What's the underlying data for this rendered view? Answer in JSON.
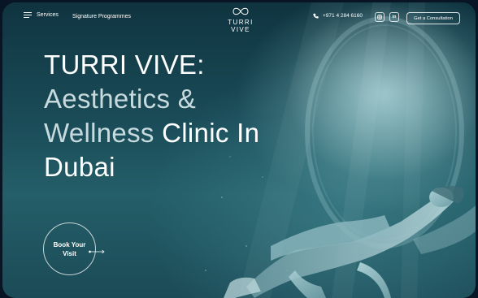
{
  "header": {
    "menu_label": "Services",
    "signature_label": "Signature Programmes",
    "logo_text": "TURRI VIVE",
    "phone": "+971 4 284 6160",
    "socials": [
      {
        "icon": "instagram-icon",
        "glyph": "◘"
      },
      {
        "icon": "linkedin-icon",
        "glyph": "in"
      }
    ],
    "cta_label": "Get a Consultation"
  },
  "hero": {
    "line1": "TURRI VIVE:",
    "line2": "Aesthetics &",
    "line3_light": "Wellness",
    "line3_bold": "Clinic In",
    "line4": "Dubai"
  },
  "book_button": {
    "line1": "Book Your",
    "line2": "Visit"
  },
  "colors": {
    "background": "#071524",
    "water_dark": "#0f3440",
    "water_light": "#245e68",
    "text": "#ffffff",
    "text_muted": "#c7dbdf"
  }
}
